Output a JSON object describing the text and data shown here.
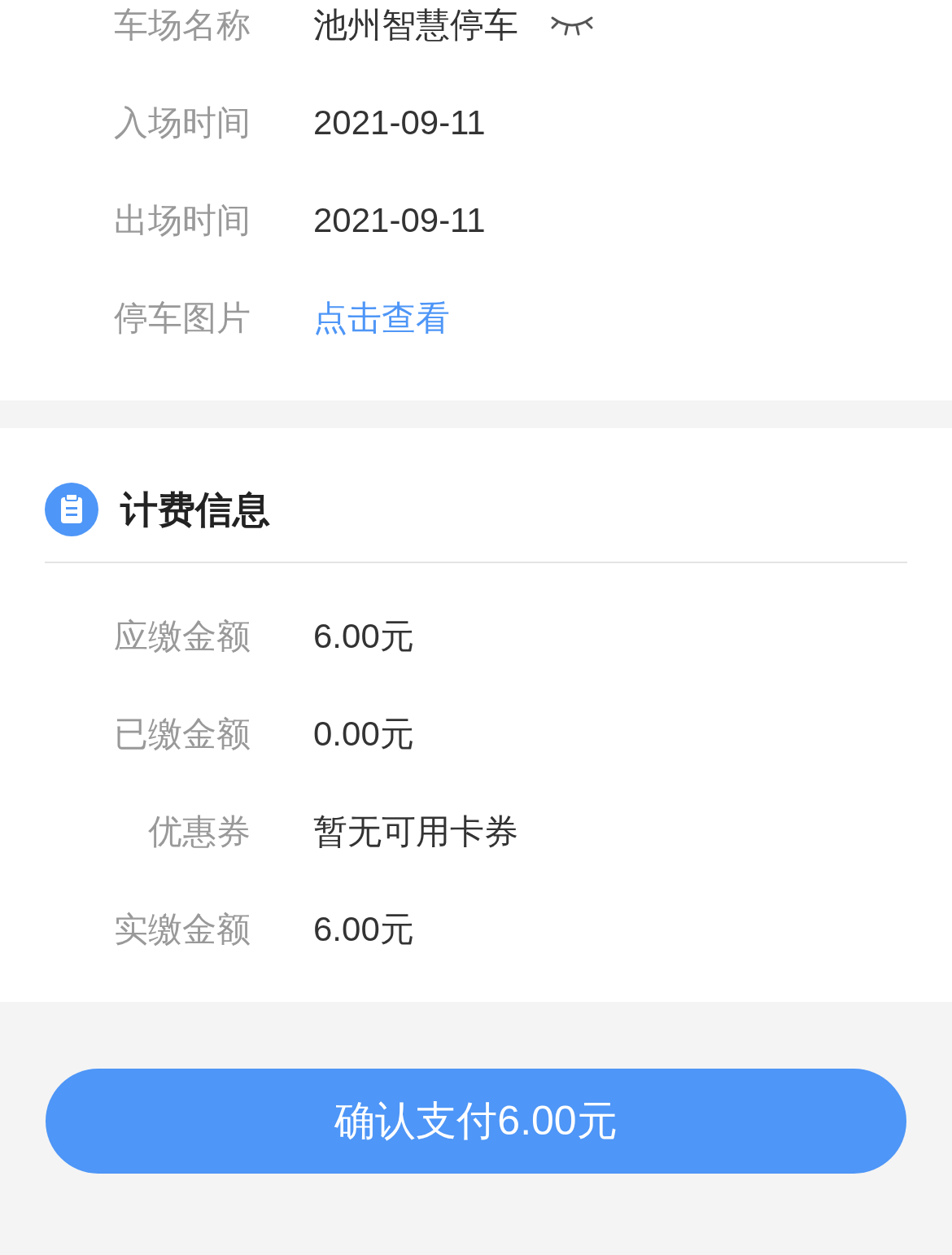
{
  "parking_info": {
    "rows": [
      {
        "label": "车场名称",
        "value": "池州智慧停车",
        "kind": "text",
        "masked": true
      },
      {
        "label": "入场时间",
        "value": "2021-09-11",
        "kind": "text",
        "masked": false
      },
      {
        "label": "出场时间",
        "value": "2021-09-11",
        "kind": "text",
        "masked": false
      },
      {
        "label": "停车图片",
        "value": "点击查看",
        "kind": "link",
        "masked": false
      }
    ]
  },
  "billing": {
    "title": "计费信息",
    "rows": [
      {
        "label": "应缴金额",
        "value": "6.00元"
      },
      {
        "label": "已缴金额",
        "value": "0.00元"
      },
      {
        "label": "优惠券",
        "value": "暂无可用卡券"
      },
      {
        "label": "实缴金额",
        "value": "6.00元"
      }
    ]
  },
  "pay_button": "确认支付6.00元"
}
